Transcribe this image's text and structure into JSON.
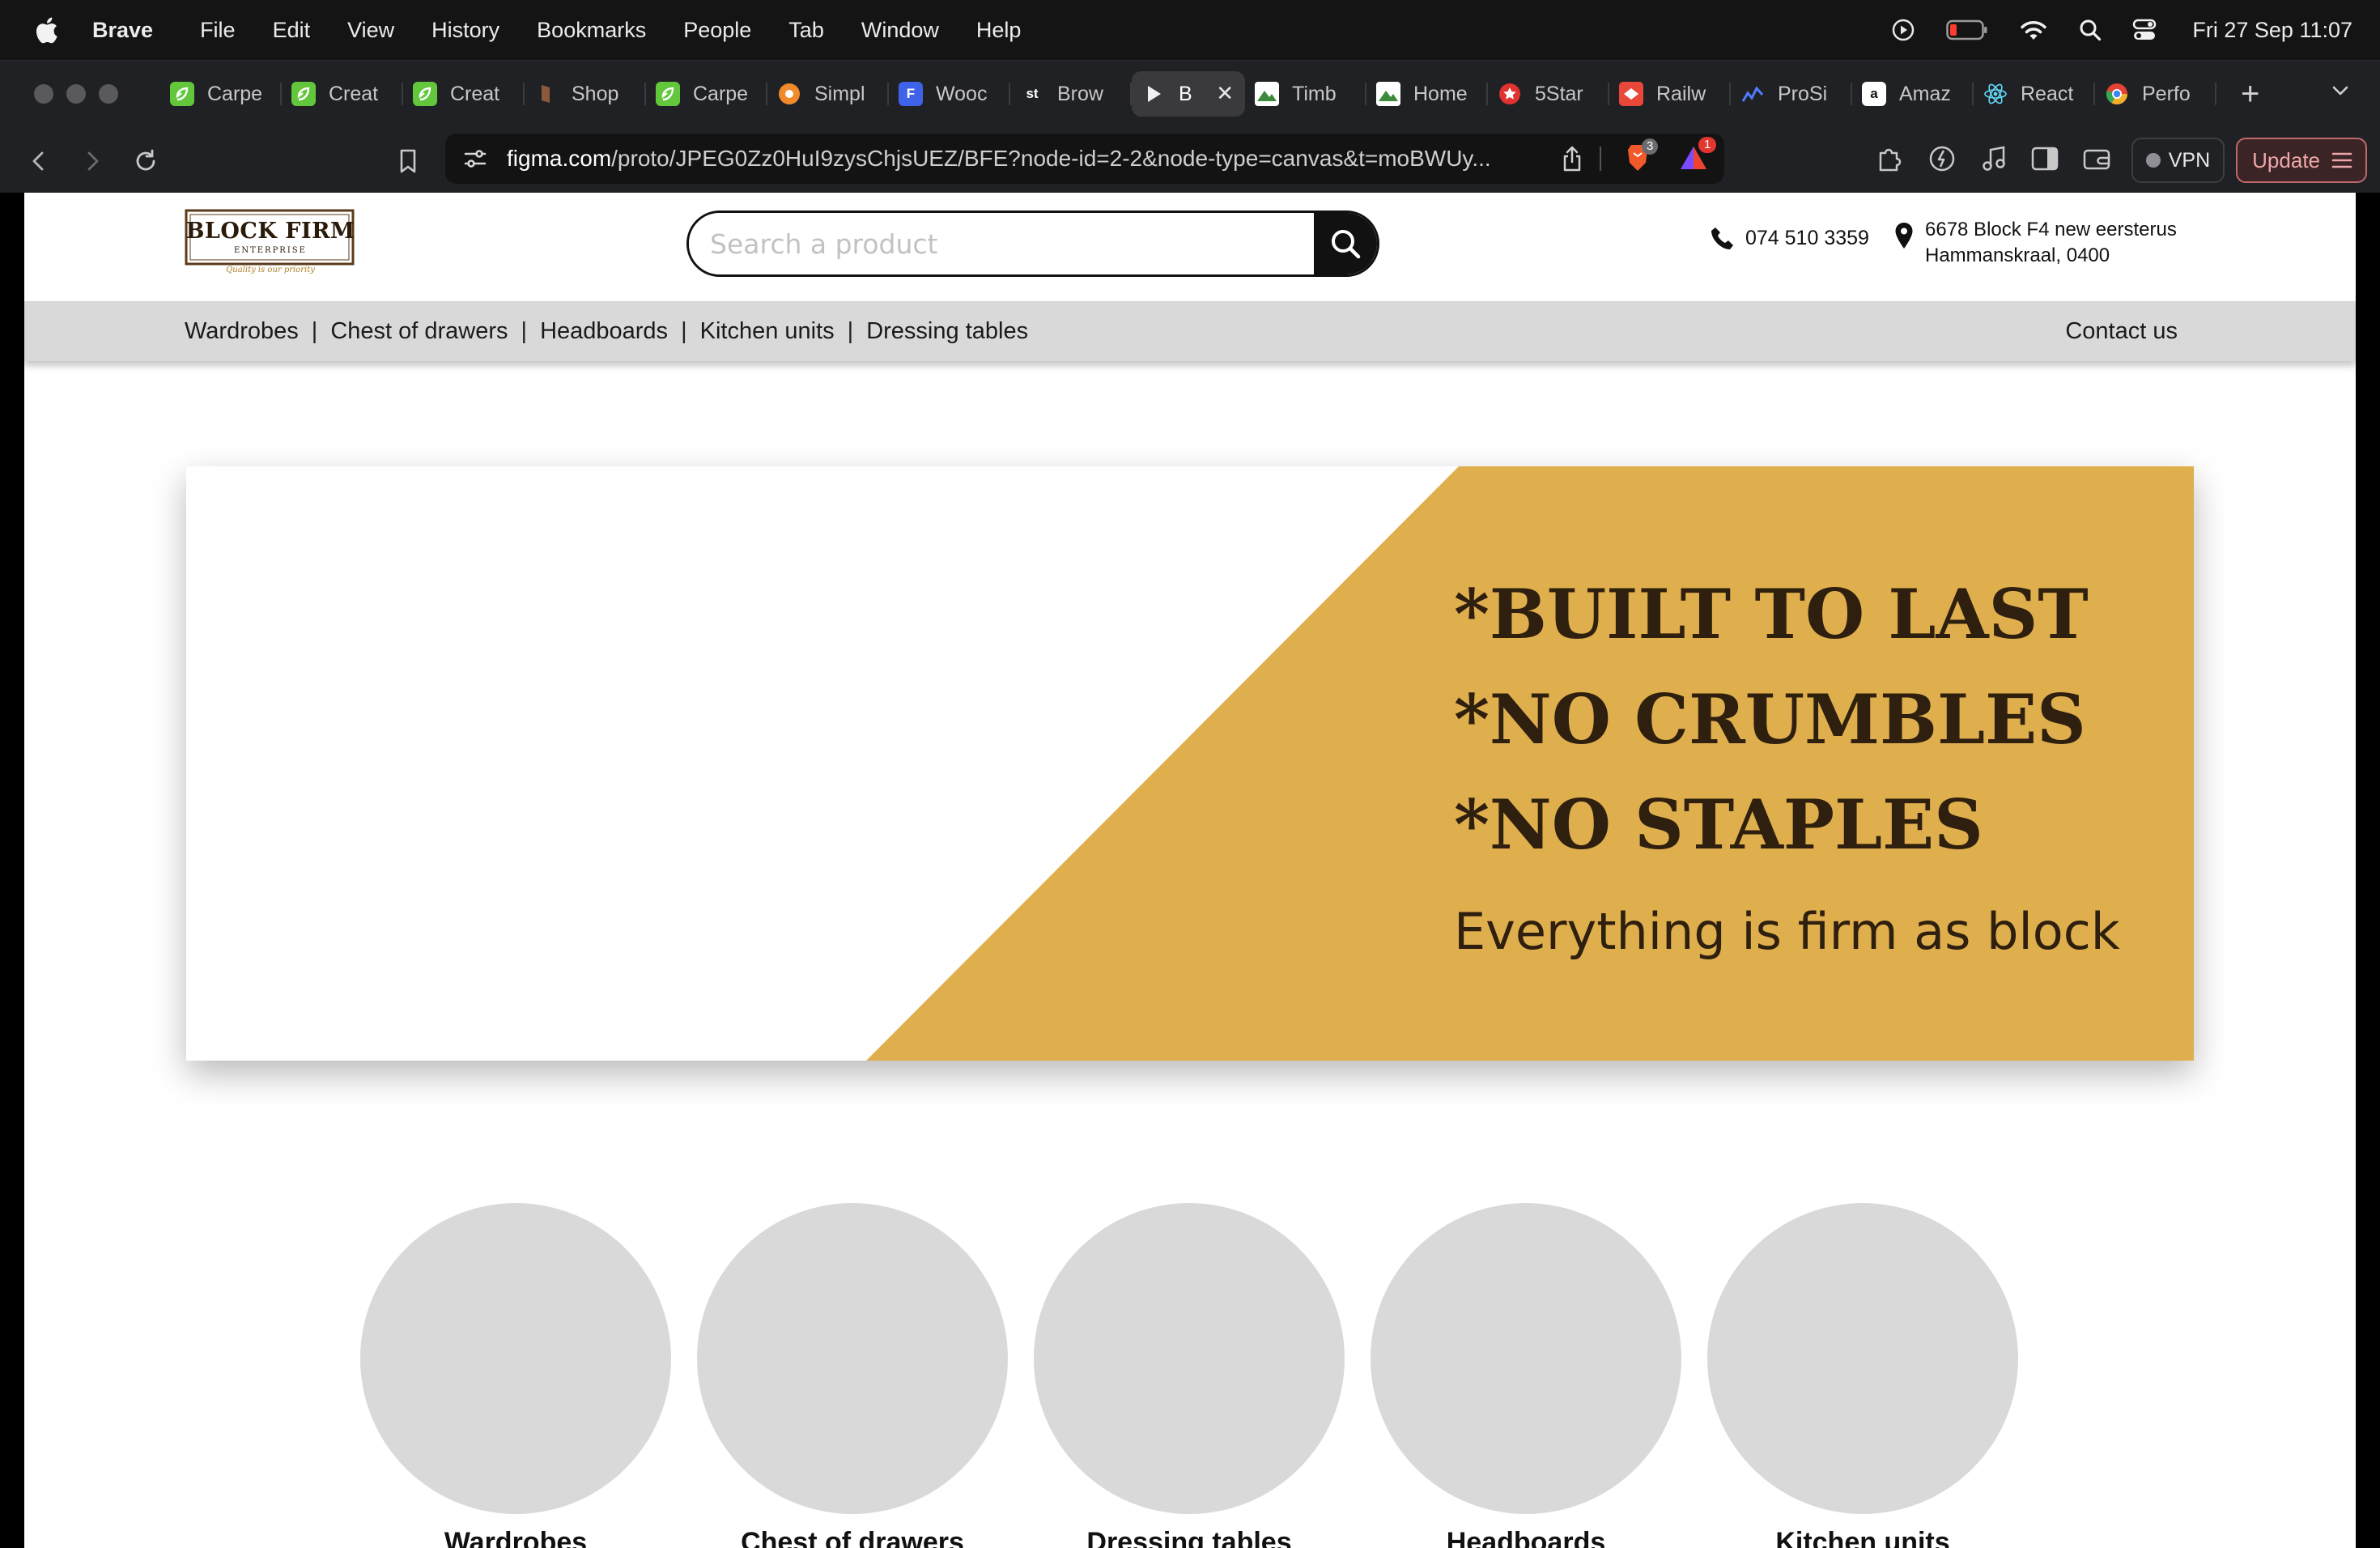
{
  "menubar": {
    "app_name": "Brave",
    "items": [
      "File",
      "Edit",
      "View",
      "History",
      "Bookmarks",
      "People",
      "Tab",
      "Window",
      "Help"
    ],
    "clock": "Fri 27 Sep  11:07"
  },
  "tabs": [
    {
      "title": "Carpe",
      "fav_color": "#62c73b",
      "fav_text": "",
      "fav_icon": "green-leaf-icon"
    },
    {
      "title": "Creat",
      "fav_color": "#62c73b",
      "fav_text": "",
      "fav_icon": "green-leaf-icon"
    },
    {
      "title": "Creat",
      "fav_color": "#62c73b",
      "fav_text": "",
      "fav_icon": "green-leaf-icon"
    },
    {
      "title": "Shop",
      "fav_color": "#8a5a3b",
      "fav_text": "",
      "fav_icon": "wood-icon"
    },
    {
      "title": "Carpe",
      "fav_color": "#62c73b",
      "fav_text": "",
      "fav_icon": "green-leaf-icon"
    },
    {
      "title": "Simpl",
      "fav_color": "#f08a2b",
      "fav_text": "",
      "fav_icon": "orange-circle-icon"
    },
    {
      "title": "Wooc",
      "fav_color": "#3f63e8",
      "fav_text": "F",
      "fav_icon": "form-icon"
    },
    {
      "title": "Brow",
      "fav_color": "#202124",
      "fav_text": "st",
      "fav_icon": "st-icon"
    },
    {
      "title": "B",
      "fav_color": "#3a3a3d",
      "fav_text": "",
      "fav_icon": "play-icon",
      "active": true
    },
    {
      "title": "Timb",
      "fav_color": "#ffffff",
      "fav_text": "",
      "fav_icon": "mountain-icon"
    },
    {
      "title": "Home",
      "fav_color": "#ffffff",
      "fav_text": "",
      "fav_icon": "mountain-icon"
    },
    {
      "title": "5Star",
      "fav_color": "#e0322f",
      "fav_text": "",
      "fav_icon": "star-badge-icon"
    },
    {
      "title": "Railw",
      "fav_color": "#e8473a",
      "fav_text": "",
      "fav_icon": "railway-icon"
    },
    {
      "title": "ProSi",
      "fav_color": "#2a3a8f",
      "fav_text": "",
      "fav_icon": "chart-icon"
    },
    {
      "title": "Amaz",
      "fav_color": "#ffffff",
      "fav_text": "a",
      "fav_icon": "amazon-icon"
    },
    {
      "title": "React",
      "fav_color": "#202124",
      "fav_text": "",
      "fav_icon": "react-icon"
    },
    {
      "title": "Perfo",
      "fav_color": "#f2b02c",
      "fav_text": "",
      "fav_icon": "chrome-icon"
    }
  ],
  "toolbar": {
    "url_host": "figma.com",
    "url_path": "/proto/JPEG0Zz0HuI9zysChjsUEZ/BFE?node-id=2-2&node-type=canvas&t=moBWUy...",
    "shield_badge": "3",
    "alert_badge": "1",
    "vpn_label": "VPN",
    "update_label": "Update"
  },
  "site": {
    "logo_name": "BLOCK FIRM",
    "logo_sub": "ENTERPRISE",
    "logo_tagline": "Quality is our priority",
    "search_placeholder": "Search a product",
    "phone": "074 510 3359",
    "address_line1": "6678 Block F4 new eersterus",
    "address_line2": "Hammanskraal, 0400",
    "nav": [
      "Wardrobes",
      "Chest of drawers",
      "Headboards",
      "Kitchen units",
      "Dressing tables"
    ],
    "nav_contact": "Contact us",
    "hero": {
      "line1": "*BUILT TO LAST",
      "line2": "*NO CRUMBLES",
      "line3": "*NO STAPLES",
      "tagline": "Everything is firm as block",
      "accent": "#e0af4d"
    },
    "categories": [
      "Wardrobes",
      "Chest of drawers",
      "Dressing tables",
      "Headboards",
      "Kitchen units"
    ]
  }
}
